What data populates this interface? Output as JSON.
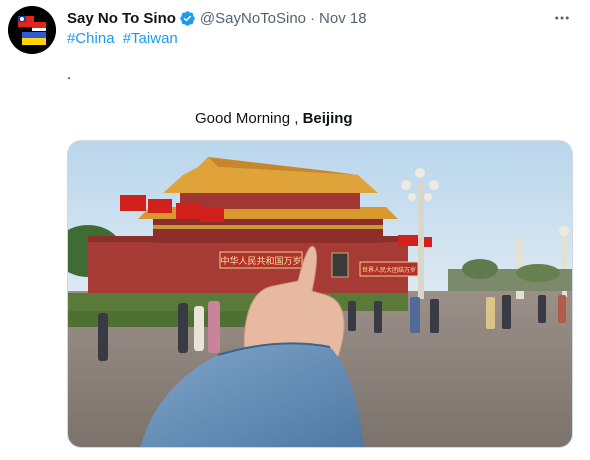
{
  "tweet": {
    "display_name": "Say No To Sino",
    "handle": "@SayNoToSino",
    "separator": "·",
    "date": "Nov 18",
    "hashtags": [
      "#China",
      "#Taiwan"
    ],
    "body_dot": ".",
    "greeting_prefix": "Good Morning ,",
    "greeting_city": "Beijing"
  },
  "photo": {
    "banner_left": "中华人民共和国万岁",
    "banner_right": "世界人民大团结万岁"
  },
  "icons": {
    "verified": "verified-badge-icon",
    "more": "more-horizontal-icon"
  },
  "colors": {
    "hashtag": "#1d9bf0",
    "secondary_text": "#536471",
    "verified": "#1d9bf0"
  }
}
